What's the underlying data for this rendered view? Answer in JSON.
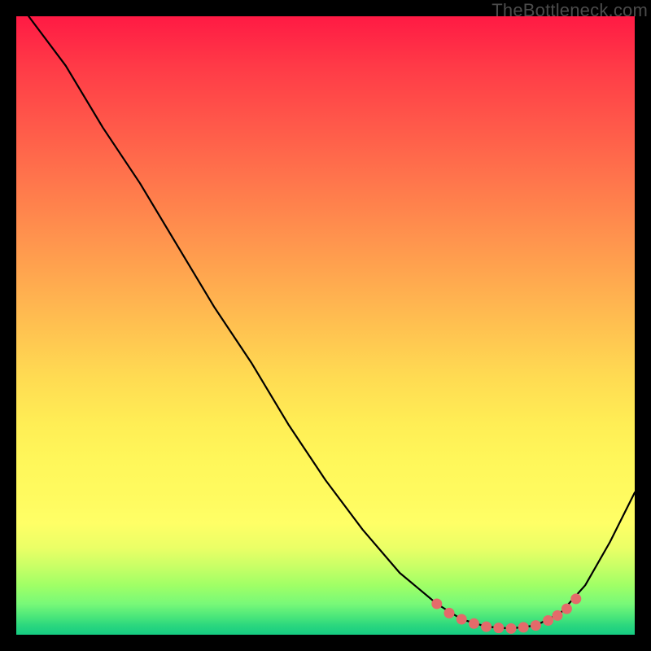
{
  "watermark": "TheBottleneck.com",
  "chart_data": {
    "type": "line",
    "title": "",
    "xlabel": "",
    "ylabel": "",
    "xlim": [
      0,
      100
    ],
    "ylim": [
      0,
      100
    ],
    "curve_points": [
      {
        "x": 2,
        "y": 100
      },
      {
        "x": 8,
        "y": 92
      },
      {
        "x": 14,
        "y": 82
      },
      {
        "x": 20,
        "y": 73
      },
      {
        "x": 26,
        "y": 63
      },
      {
        "x": 32,
        "y": 53
      },
      {
        "x": 38,
        "y": 44
      },
      {
        "x": 44,
        "y": 34
      },
      {
        "x": 50,
        "y": 25
      },
      {
        "x": 56,
        "y": 17
      },
      {
        "x": 62,
        "y": 10
      },
      {
        "x": 68,
        "y": 5
      },
      {
        "x": 72,
        "y": 2.5
      },
      {
        "x": 76,
        "y": 1.3
      },
      {
        "x": 80,
        "y": 1.0
      },
      {
        "x": 84,
        "y": 1.5
      },
      {
        "x": 88,
        "y": 3.5
      },
      {
        "x": 92,
        "y": 8
      },
      {
        "x": 96,
        "y": 15
      },
      {
        "x": 100,
        "y": 23
      }
    ],
    "highlight_points": [
      {
        "x": 68,
        "y": 5.0
      },
      {
        "x": 70,
        "y": 3.5
      },
      {
        "x": 72,
        "y": 2.5
      },
      {
        "x": 74,
        "y": 1.8
      },
      {
        "x": 76,
        "y": 1.3
      },
      {
        "x": 78,
        "y": 1.1
      },
      {
        "x": 80,
        "y": 1.0
      },
      {
        "x": 82,
        "y": 1.2
      },
      {
        "x": 84,
        "y": 1.5
      },
      {
        "x": 86,
        "y": 2.3
      },
      {
        "x": 87.5,
        "y": 3.1
      },
      {
        "x": 89,
        "y": 4.2
      },
      {
        "x": 90.5,
        "y": 5.8
      }
    ],
    "colors": {
      "curve": "#000000",
      "highlight": "#e46a6a"
    }
  }
}
